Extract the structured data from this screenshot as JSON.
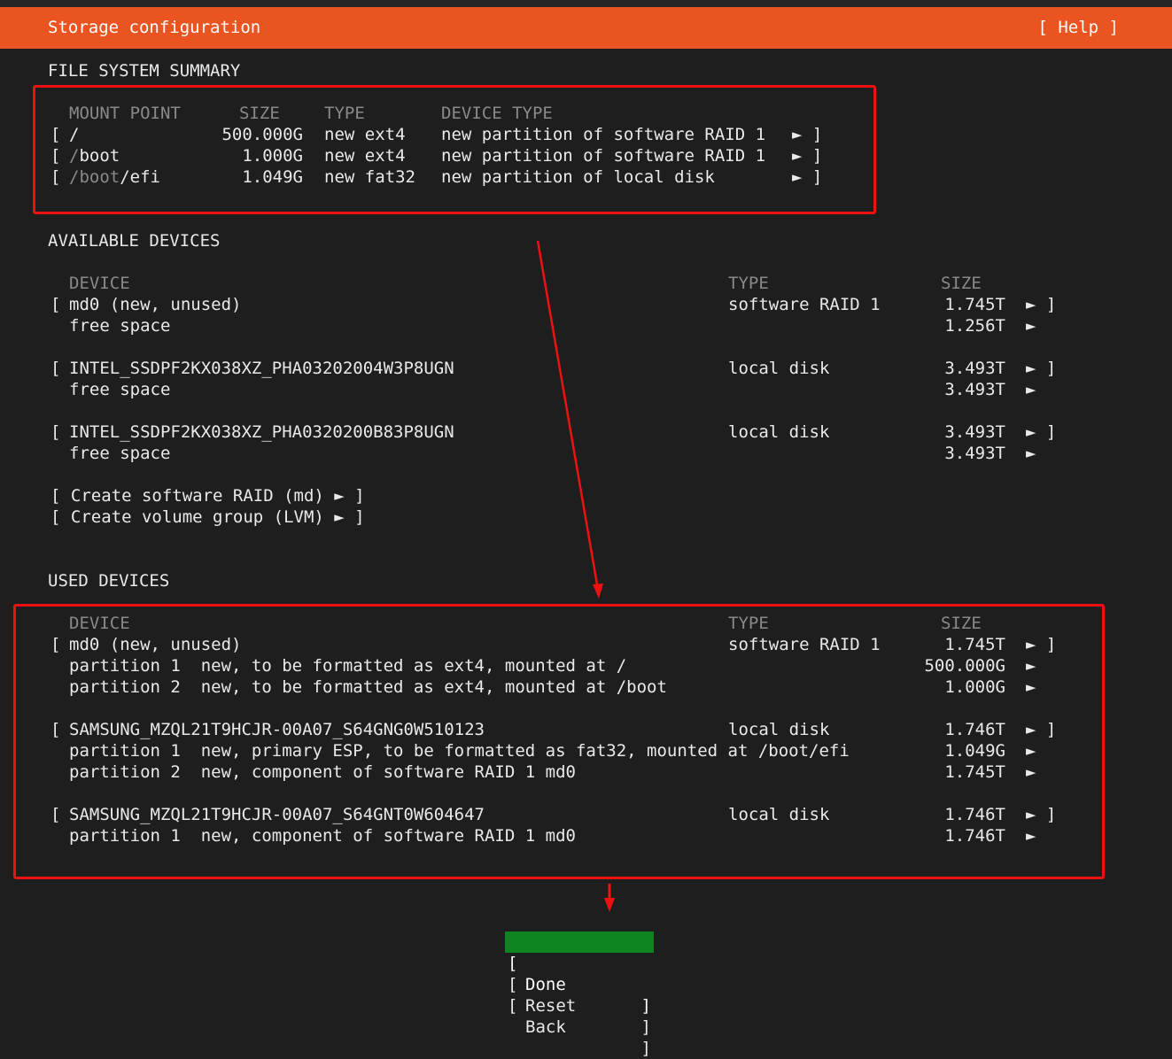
{
  "header": {
    "title": "Storage configuration",
    "help": "[ Help ]"
  },
  "fs_summary": {
    "heading": "FILE SYSTEM SUMMARY",
    "columns": {
      "mount": "MOUNT POINT",
      "size": "SIZE",
      "type": "TYPE",
      "device_type": "DEVICE TYPE"
    },
    "rows": [
      {
        "bracket": "[",
        "mount_dim": "",
        "mount": "/",
        "size": "500.000G",
        "type": "new ext4",
        "device_type": "new partition of software RAID 1",
        "end": "► ]"
      },
      {
        "bracket": "[",
        "mount_dim": "/",
        "mount": "boot",
        "size": "1.000G",
        "type": "new ext4",
        "device_type": "new partition of software RAID 1",
        "end": "► ]"
      },
      {
        "bracket": "[",
        "mount_dim": "/boot",
        "mount": "/efi",
        "size": "1.049G",
        "type": "new fat32",
        "device_type": "new partition of local disk",
        "end": "► ]"
      }
    ]
  },
  "available": {
    "heading": "AVAILABLE DEVICES",
    "columns": {
      "device": "DEVICE",
      "type": "TYPE",
      "size": "SIZE"
    },
    "groups": [
      {
        "name": "md0 (new, unused)",
        "type": "software RAID 1",
        "size": "1.745T",
        "end": "► ]",
        "sub": [
          {
            "label": "free space",
            "size": "1.256T",
            "end": "►"
          }
        ]
      },
      {
        "name": "INTEL_SSDPF2KX038XZ_PHA03202004W3P8UGN",
        "type": "local disk",
        "size": "3.493T",
        "end": "► ]",
        "sub": [
          {
            "label": "free space",
            "size": "3.493T",
            "end": "►"
          }
        ]
      },
      {
        "name": "INTEL_SSDPF2KX038XZ_PHA0320200B83P8UGN",
        "type": "local disk",
        "size": "3.493T",
        "end": "► ]",
        "sub": [
          {
            "label": "free space",
            "size": "3.493T",
            "end": "►"
          }
        ]
      }
    ],
    "actions": [
      "[ Create software RAID (md) ► ]",
      "[ Create volume group (LVM) ► ]"
    ]
  },
  "used": {
    "heading": "USED DEVICES",
    "columns": {
      "device": "DEVICE",
      "type": "TYPE",
      "size": "SIZE"
    },
    "groups": [
      {
        "name": "md0 (new, unused)",
        "type": "software RAID 1",
        "size": "1.745T",
        "end": "► ]",
        "sub": [
          {
            "label": "partition 1  new, to be formatted as ext4, mounted at /",
            "size": "500.000G",
            "end": "►"
          },
          {
            "label": "partition 2  new, to be formatted as ext4, mounted at /boot",
            "size": "1.000G",
            "end": "►"
          }
        ]
      },
      {
        "name": "SAMSUNG_MZQL21T9HCJR-00A07_S64GNG0W510123",
        "type": "local disk",
        "size": "1.746T",
        "end": "► ]",
        "sub": [
          {
            "label": "partition 1  new, primary ESP, to be formatted as fat32, mounted at /boot/efi",
            "size": "1.049G",
            "end": "►"
          },
          {
            "label": "partition 2  new, component of software RAID 1 md0",
            "size": "1.745T",
            "end": "►"
          }
        ]
      },
      {
        "name": "SAMSUNG_MZQL21T9HCJR-00A07_S64GNT0W604647",
        "type": "local disk",
        "size": "1.746T",
        "end": "► ]",
        "sub": [
          {
            "label": "partition 1  new, component of software RAID 1 md0",
            "size": "1.746T",
            "end": "►"
          }
        ]
      }
    ]
  },
  "buttons": [
    {
      "label": "Done",
      "selected": true
    },
    {
      "label": "Reset",
      "selected": false
    },
    {
      "label": "Back",
      "selected": false
    }
  ],
  "colors": {
    "header_bg": "#e95420",
    "selected_btn": "#0e8420",
    "annotation": "#ee1111"
  }
}
